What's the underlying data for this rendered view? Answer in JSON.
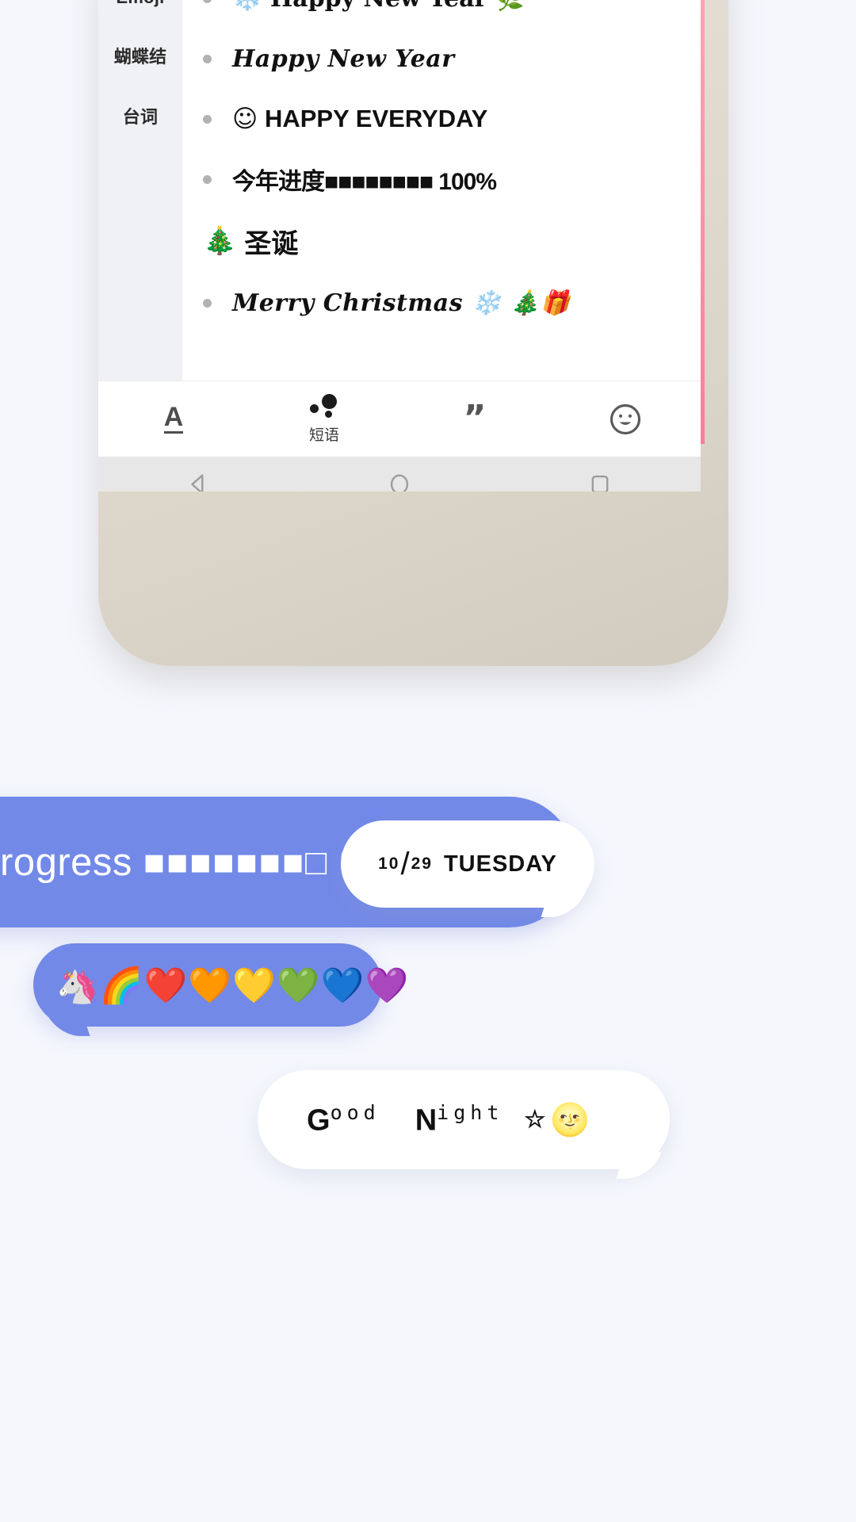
{
  "keyboard": {
    "sidebar": {
      "items": [
        {
          "label": "Emoji",
          "name": "sidebar-item-emoji"
        },
        {
          "label": "蝴蝶结",
          "name": "sidebar-item-bowknot"
        },
        {
          "label": "台词",
          "name": "sidebar-item-lines"
        }
      ]
    },
    "phrases": [
      {
        "type": "item",
        "emoji_lead": "❄️",
        "text": "Happy New Year",
        "emoji_trail": "🌿",
        "style": "slab"
      },
      {
        "type": "item",
        "emoji_lead": "",
        "text": "Happy New Year",
        "emoji_trail": "",
        "style": "script"
      },
      {
        "type": "item",
        "emoji_lead": "☺",
        "text": "HAPPY EVERYDAY",
        "emoji_trail": "͝",
        "style": "plain"
      },
      {
        "type": "item",
        "emoji_lead": "",
        "text": "今年进度■■■■■■■■ 100%",
        "emoji_trail": "",
        "style": "squares"
      }
    ],
    "section": {
      "emoji": "🎄",
      "title": "圣诞"
    },
    "section_items": [
      {
        "emoji_lead": "",
        "text": "Merry Christmas",
        "emoji_trail": "❄️ 🎄🎁",
        "style": "script"
      }
    ],
    "toolbar": [
      {
        "name": "text-style-tab",
        "glyph": "A",
        "label": ""
      },
      {
        "name": "phrases-tab",
        "glyph": "dots",
        "label": "短语"
      },
      {
        "name": "quotes-tab",
        "glyph": "”",
        "label": ""
      },
      {
        "name": "emoji-tab",
        "glyph": "smile",
        "label": ""
      }
    ],
    "navbar": [
      {
        "name": "nav-back-button",
        "icon": "triangle-left-icon"
      },
      {
        "name": "nav-home-button",
        "icon": "circle-icon"
      },
      {
        "name": "nav-recents-button",
        "icon": "square-icon"
      }
    ]
  },
  "chat": {
    "progress_bubble": {
      "text_prefix": "rogress",
      "blocks": "■■■■■■■□",
      "percent": "90%",
      "color": "#7289e8"
    },
    "date_bubble": {
      "month": "10",
      "day_num": "29",
      "weekday": "TUESDAY"
    },
    "emoji_bubble": {
      "emojis": "🦄🌈❤️🧡💛💚💙💜"
    },
    "night_bubble": {
      "word1_cap": "G",
      "word1_rest": "ood",
      "word2_cap": "N",
      "word2_rest": "ight",
      "star": "☆",
      "moon": "🌝"
    }
  },
  "colors": {
    "background": "#f5f7fd",
    "bubble_blue": "#7289e8",
    "bubble_white": "#ffffff",
    "phone_bezel": "#ddd6ca",
    "sidebar_bg": "#f0f1f4"
  }
}
